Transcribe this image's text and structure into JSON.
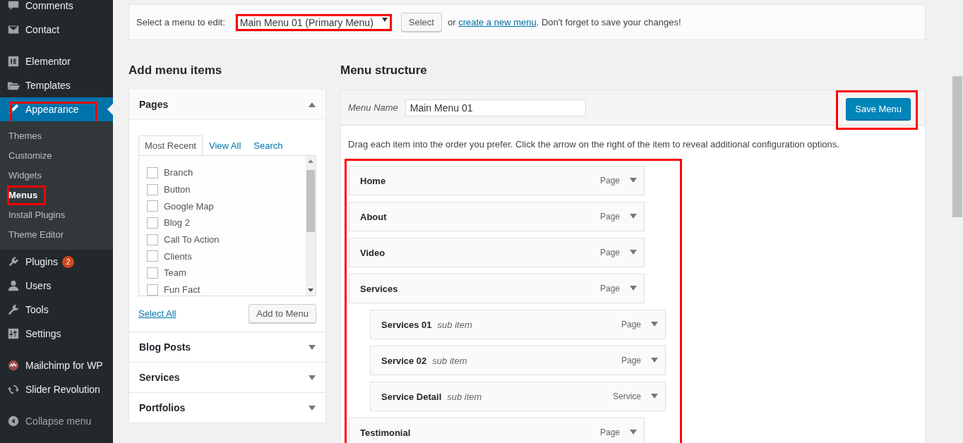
{
  "sidebar": {
    "groups": [
      [
        {
          "label": "Comments",
          "current": false
        },
        {
          "label": "Contact",
          "current": false
        }
      ],
      [
        {
          "label": "Elementor",
          "current": false
        },
        {
          "label": "Templates",
          "current": false
        },
        {
          "label": "Appearance",
          "current": true,
          "highlighted": true,
          "children": [
            {
              "label": "Themes",
              "selected": false,
              "highlighted": false
            },
            {
              "label": "Customize",
              "selected": false,
              "highlighted": false
            },
            {
              "label": "Widgets",
              "selected": false,
              "highlighted": false
            },
            {
              "label": "Menus",
              "selected": true,
              "highlighted": true
            },
            {
              "label": "Install Plugins",
              "selected": false,
              "highlighted": false
            },
            {
              "label": "Theme Editor",
              "selected": false,
              "highlighted": false
            }
          ]
        },
        {
          "label": "Plugins",
          "current": false,
          "badge": "2"
        },
        {
          "label": "Users",
          "current": false
        },
        {
          "label": "Tools",
          "current": false
        },
        {
          "label": "Settings",
          "current": false
        }
      ],
      [
        {
          "label": "Mailchimp for WP",
          "current": false
        },
        {
          "label": "Slider Revolution",
          "current": false
        }
      ]
    ],
    "collapse": "Collapse menu"
  },
  "menu_select": {
    "label": "Select a menu to edit:",
    "value": "Main Menu 01 (Primary Menu)",
    "highlighted": true,
    "button": "Select",
    "text_before": "or ",
    "link": "create a new menu",
    "text_after": ". Don't forget to save your changes!"
  },
  "add_menu_items": {
    "heading": "Add menu items",
    "sections": [
      {
        "title": "Pages",
        "expanded": true,
        "tabs": [
          {
            "label": "Most Recent",
            "selected": true
          },
          {
            "label": "View All",
            "selected": false
          },
          {
            "label": "Search",
            "selected": false
          }
        ],
        "pages": [
          {
            "label": "Branch",
            "checked": false
          },
          {
            "label": "Button",
            "checked": false
          },
          {
            "label": "Google Map",
            "checked": false
          },
          {
            "label": "Blog 2",
            "checked": false
          },
          {
            "label": "Call To Action",
            "checked": false
          },
          {
            "label": "Clients",
            "checked": false
          },
          {
            "label": "Team",
            "checked": false
          },
          {
            "label": "Fun Fact",
            "checked": false
          }
        ],
        "select_all": "Select All",
        "add_button": "Add to Menu"
      },
      {
        "title": "Blog Posts",
        "expanded": false
      },
      {
        "title": "Services",
        "expanded": false
      },
      {
        "title": "Portfolios",
        "expanded": false
      }
    ]
  },
  "menu_structure": {
    "heading": "Menu structure",
    "name_label": "Menu Name",
    "name_value": "Main Menu 01",
    "save_button": "Save Menu",
    "save_highlighted": true,
    "instructions": "Drag each item into the order you prefer. Click the arrow on the right of the item to reveal additional configuration options.",
    "items_highlighted": true,
    "items": [
      {
        "title": "Home",
        "type": "Page"
      },
      {
        "title": "About",
        "type": "Page"
      },
      {
        "title": "Video",
        "type": "Page"
      },
      {
        "title": "Services",
        "type": "Page",
        "children": [
          {
            "title": "Services 01",
            "note": "sub item",
            "type": "Page"
          },
          {
            "title": "Service 02",
            "note": "sub item",
            "type": "Page"
          },
          {
            "title": "Service Detail",
            "note": "sub item",
            "type": "Service"
          }
        ]
      },
      {
        "title": "Testimonial",
        "type": "Page"
      }
    ]
  }
}
